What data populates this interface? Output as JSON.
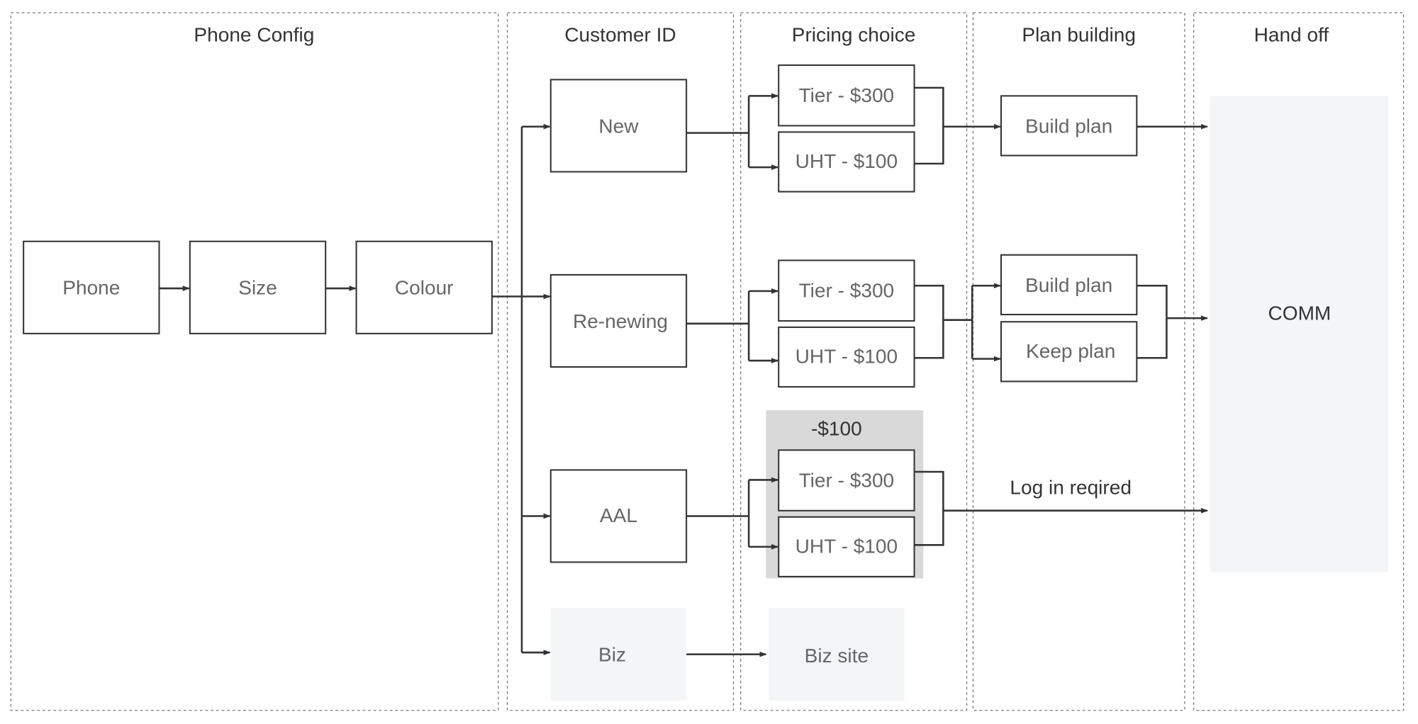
{
  "lanes": {
    "phone_config": "Phone Config",
    "customer_id": "Customer ID",
    "pricing_choice": "Pricing choice",
    "plan_building": "Plan building",
    "hand_off": "Hand off"
  },
  "phone_config": {
    "phone": "Phone",
    "size": "Size",
    "colour": "Colour"
  },
  "customers": {
    "new": "New",
    "renewing": "Re-newing",
    "aal": "AAL",
    "biz": "Biz"
  },
  "pricing": {
    "tier": "Tier - $300",
    "uht": "UHT - $100",
    "discount": "-$100",
    "biz_site": "Biz site"
  },
  "plans": {
    "build": "Build plan",
    "keep": "Keep plan",
    "login_note": "Log in reqired"
  },
  "handoff": {
    "comm": "COMM"
  },
  "colors": {
    "line": "#333333",
    "discount_bg": "#d9d9d9",
    "soft_box": "#f4f5f7"
  }
}
